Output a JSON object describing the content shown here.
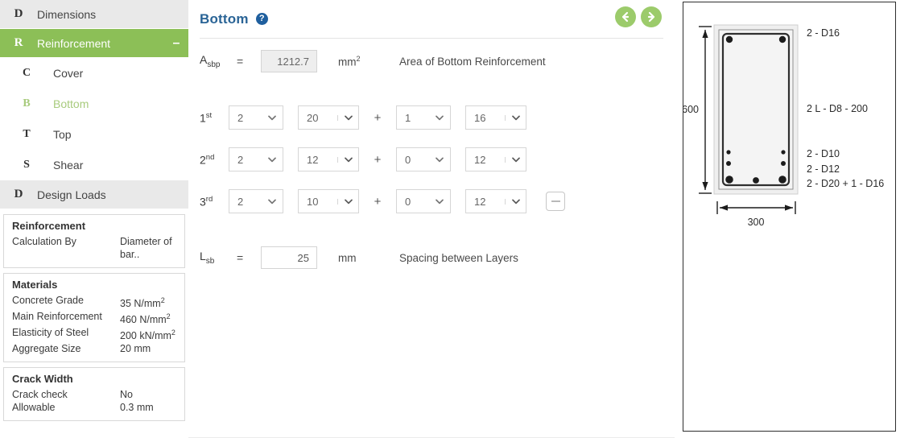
{
  "sidebar": {
    "groups": [
      {
        "letter": "D",
        "label": "Dimensions",
        "active": false,
        "toggle": ""
      },
      {
        "letter": "R",
        "label": "Reinforcement",
        "active": true,
        "toggle": "–"
      }
    ],
    "sub_items": [
      {
        "letter": "C",
        "label": "Cover",
        "selected": false
      },
      {
        "letter": "B",
        "label": "Bottom",
        "selected": true
      },
      {
        "letter": "T",
        "label": "Top",
        "selected": false
      },
      {
        "letter": "S",
        "label": "Shear",
        "selected": false
      }
    ],
    "design_loads": {
      "letter": "D",
      "label": "Design Loads"
    },
    "cards": [
      {
        "title": "Reinforcement",
        "rows": [
          {
            "key": "Calculation By",
            "value": "Diameter of bar.."
          }
        ]
      },
      {
        "title": "Materials",
        "rows": [
          {
            "key": "Concrete Grade",
            "value": "35 N/mm",
            "sup": "2"
          },
          {
            "key": "Main Reinforcement",
            "value": "460 N/mm",
            "sup": "2"
          },
          {
            "key": "Elasticity of Steel",
            "value": "200 kN/mm",
            "sup": "2"
          },
          {
            "key": "Aggregate Size",
            "value": "20 mm",
            "sup": ""
          }
        ]
      },
      {
        "title": "Crack Width",
        "rows": [
          {
            "key": "Crack check",
            "value": "No",
            "sup": ""
          },
          {
            "key": "Allowable",
            "value": "0.3 mm",
            "sup": ""
          }
        ]
      }
    ]
  },
  "main": {
    "title": "Bottom",
    "help_glyph": "?",
    "prev_label": "Previous",
    "next_label": "Next",
    "area_row": {
      "symbol": "A",
      "subscript": "sbp",
      "equals": "=",
      "value": "1212.7",
      "unit": "mm",
      "unit_sup": "2",
      "description": "Area of Bottom Reinforcement"
    },
    "bar_rows": [
      {
        "ordinal": "1",
        "ordinal_sup": "st",
        "count_a": "2",
        "dia_a": "20",
        "plus": "+",
        "count_b": "1",
        "dia_b": "16",
        "has_minus": false
      },
      {
        "ordinal": "2",
        "ordinal_sup": "nd",
        "count_a": "2",
        "dia_a": "12",
        "plus": "+",
        "count_b": "0",
        "dia_b": "12",
        "has_minus": false
      },
      {
        "ordinal": "3",
        "ordinal_sup": "rd",
        "count_a": "2",
        "dia_a": "10",
        "plus": "+",
        "count_b": "0",
        "dia_b": "12",
        "has_minus": true
      }
    ],
    "spacing_row": {
      "symbol": "L",
      "subscript": "sb",
      "equals": "=",
      "value": "25",
      "unit": "mm",
      "description": "Spacing between Layers"
    }
  },
  "diagram": {
    "depth_label": "600",
    "width_label": "300",
    "annotations": [
      {
        "text": "2 - D16"
      },
      {
        "text": "2 L - D8 - 200"
      },
      {
        "text": "2 - D10"
      },
      {
        "text": "2 - D12"
      },
      {
        "text": "2 - D20 + 1 - D16"
      }
    ]
  },
  "colors": {
    "accent_green": "#8cbf57",
    "title_blue": "#2a6496",
    "help_blue": "#1f5f9e",
    "arrow_green": "#9ccb6b"
  }
}
